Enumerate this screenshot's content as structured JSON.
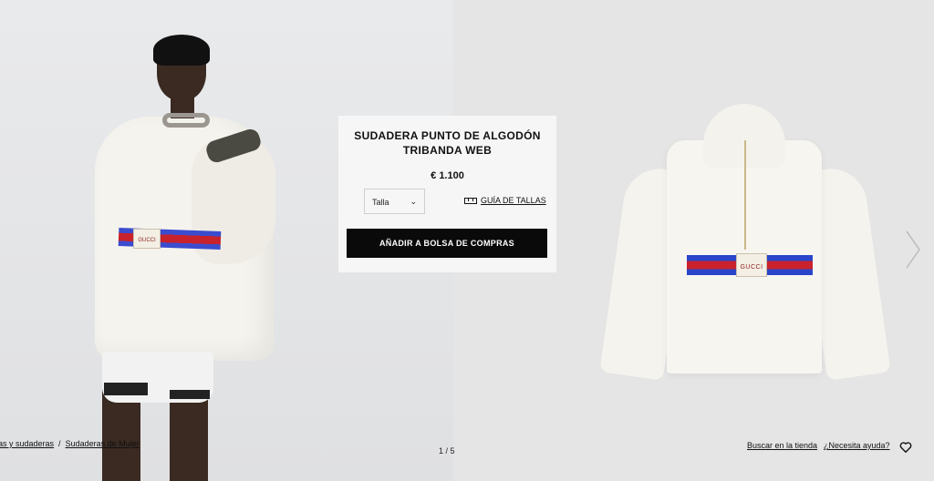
{
  "product": {
    "title_line1": "SUDADERA PUNTO DE ALGODÓN",
    "title_line2": "TRIBANDA WEB",
    "price": "€ 1.100",
    "size_label": "Talla",
    "size_guide_label": "GUÍA DE TALLAS",
    "add_to_bag_label": "AÑADIR A BOLSA DE COMPRAS"
  },
  "images": {
    "label_text_left": "GUCCI",
    "label_text_right": "GUCCI"
  },
  "breadcrumb": {
    "item1": "as y sudaderas",
    "separator": "/",
    "item2": "Sudaderas de Mujer"
  },
  "pager": {
    "text": "1 / 5"
  },
  "footer": {
    "store_link": "Buscar en la tienda",
    "help_link": "¿Necesita ayuda?"
  },
  "icons": {
    "heart": "heart-icon",
    "next": "chevron-right-icon",
    "ruler": "ruler-icon",
    "chevron": "chevron-down-icon"
  },
  "colors": {
    "button_bg": "#0a0a0a",
    "stripe_blue": "#2a45c9",
    "stripe_red": "#c8222c"
  }
}
